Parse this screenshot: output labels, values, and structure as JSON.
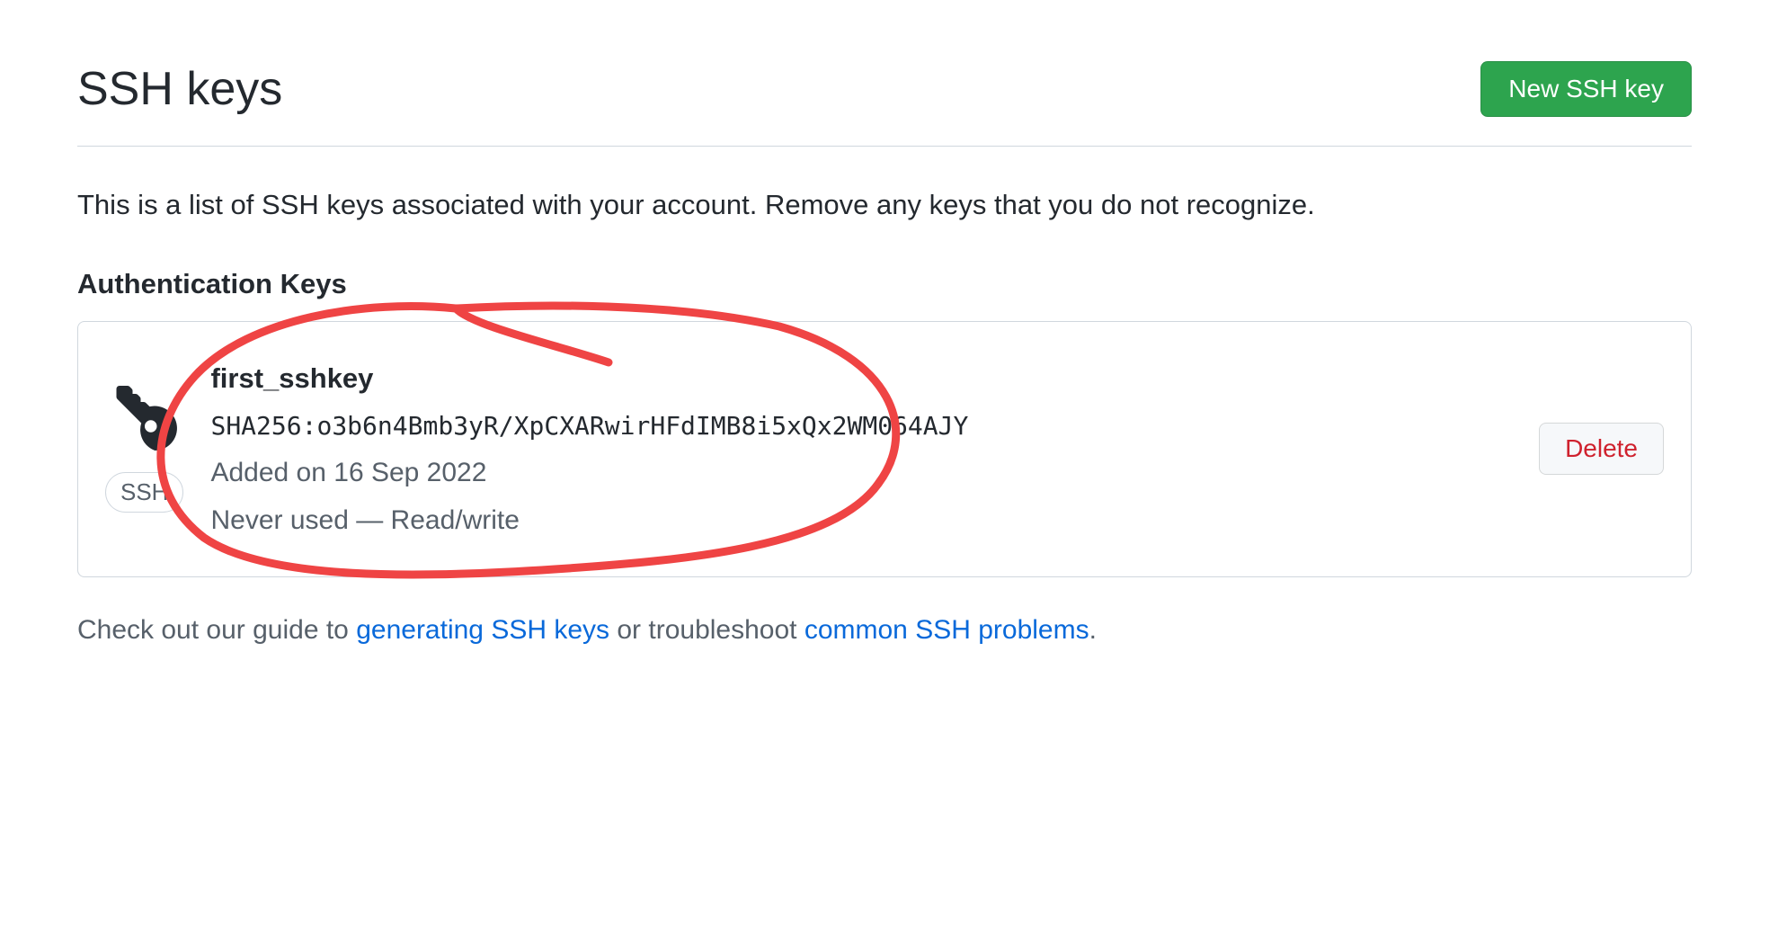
{
  "header": {
    "title": "SSH keys",
    "new_button": "New SSH key"
  },
  "description": "This is a list of SSH keys associated with your account. Remove any keys that you do not recognize.",
  "section_heading": "Authentication Keys",
  "keys": [
    {
      "name": "first_sshkey",
      "fingerprint": "SHA256:o3b6n4Bmb3yR/XpCXARwirHFdIMB8i5xQx2WM064AJY",
      "added": "Added on 16 Sep 2022",
      "usage": "Never used — Read/write",
      "badge": "SSH",
      "delete_label": "Delete"
    }
  ],
  "footer": {
    "prefix": "Check out our guide to ",
    "link1": "generating SSH keys",
    "middle": " or troubleshoot ",
    "link2": "common SSH problems",
    "suffix": "."
  }
}
